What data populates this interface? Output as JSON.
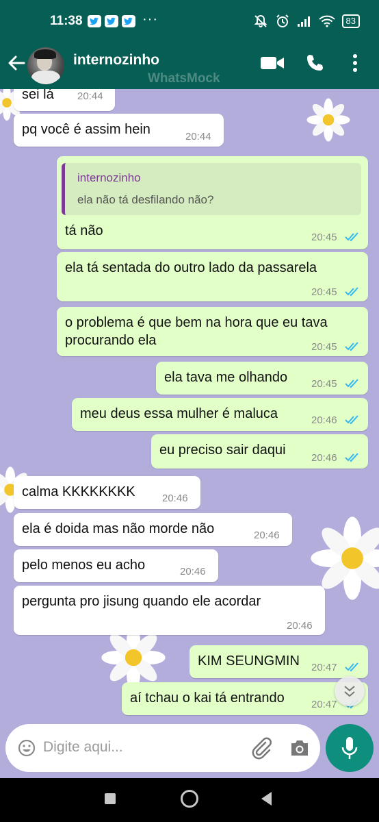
{
  "status_bar": {
    "time": "11:38",
    "battery": "83",
    "more": "···"
  },
  "header": {
    "contact_name": "internozinho",
    "watermark": "WhatsMock",
    "icons": [
      "back-arrow-icon",
      "video-call-icon",
      "phone-icon",
      "more-vert-icon"
    ]
  },
  "messages": [
    {
      "dir": "in",
      "text": "sei lá",
      "time": "20:44"
    },
    {
      "dir": "in",
      "text": "pq você é assim hein",
      "time": "20:44"
    },
    {
      "dir": "out",
      "reply_to_name": "internozinho",
      "reply_to_text": "ela não tá desfilando não?",
      "text": "tá não",
      "time": "20:45",
      "status": "read"
    },
    {
      "dir": "out",
      "text": "ela tá sentada do outro lado da passarela",
      "time": "20:45",
      "status": "read"
    },
    {
      "dir": "out",
      "text_line1": "o problema é que bem na hora que eu tava",
      "text_line2": "procurando ela",
      "time": "20:45",
      "status": "read"
    },
    {
      "dir": "out",
      "text": "ela tava me olhando",
      "time": "20:45",
      "status": "read"
    },
    {
      "dir": "out",
      "text": "meu deus essa mulher é maluca",
      "time": "20:46",
      "status": "read"
    },
    {
      "dir": "out",
      "text": "eu preciso sair daqui",
      "time": "20:46",
      "status": "read"
    },
    {
      "dir": "in",
      "text": "calma KKKKKKKK",
      "time": "20:46"
    },
    {
      "dir": "in",
      "text": "ela é doida mas não morde não",
      "time": "20:46"
    },
    {
      "dir": "in",
      "text": "pelo menos eu acho",
      "time": "20:46"
    },
    {
      "dir": "in",
      "text": "pergunta pro jisung quando ele acordar",
      "time": "20:46"
    },
    {
      "dir": "out",
      "text": "KIM SEUNGMIN",
      "time": "20:47",
      "status": "read"
    },
    {
      "dir": "out",
      "text": "aí tchau o kai tá entrando",
      "time": "20:47",
      "status": "read"
    }
  ],
  "composer": {
    "placeholder": "Digite aqui...",
    "icons": [
      "emoji-icon",
      "attach-icon",
      "camera-icon",
      "mic-icon"
    ]
  },
  "colors": {
    "header": "#075e54",
    "chat_background": "#b3addb",
    "outgoing_bubble": "#e2ffc8",
    "incoming_bubble": "#ffffff",
    "read_ticks": "#34b7f1",
    "mic_button": "#0e8f7e"
  }
}
